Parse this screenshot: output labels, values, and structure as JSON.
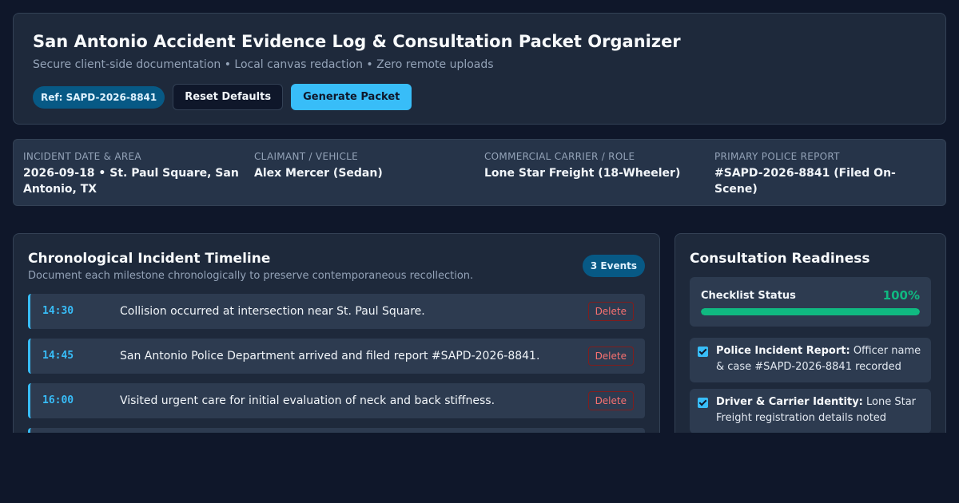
{
  "header": {
    "title": "San Antonio Accident Evidence Log & Consultation Packet Organizer",
    "subtitle": "Secure client-side documentation • Local canvas redaction • Zero remote uploads",
    "ref_badge": "Ref: SAPD-2026-8841",
    "reset_label": "Reset Defaults",
    "generate_label": "Generate Packet"
  },
  "summary": [
    {
      "label": "INCIDENT DATE & AREA",
      "value": "2026-09-18 • St. Paul Square, San Antonio, TX"
    },
    {
      "label": "CLAIMANT / VEHICLE",
      "value": "Alex Mercer (Sedan)"
    },
    {
      "label": "COMMERCIAL CARRIER / ROLE",
      "value": "Lone Star Freight (18-Wheeler)"
    },
    {
      "label": "PRIMARY POLICE REPORT",
      "value": "#SAPD-2026-8841 (Filed On-Scene)"
    }
  ],
  "timeline": {
    "title": "Chronological Incident Timeline",
    "subtitle": "Document each milestone chronologically to preserve contemporaneous recollection.",
    "count_badge": "3 Events",
    "delete_label": "Delete",
    "events": [
      {
        "time": "14:30",
        "description": "Collision occurred at intersection near St. Paul Square."
      },
      {
        "time": "14:45",
        "description": "San Antonio Police Department arrived and filed report #SAPD-2026-8841."
      },
      {
        "time": "16:00",
        "description": "Visited urgent care for initial evaluation of neck and back stiffness."
      }
    ]
  },
  "readiness": {
    "title": "Consultation Readiness",
    "status_label": "Checklist Status",
    "status_percent_text": "100%",
    "status_percent": 100,
    "accent_color": "#10b981",
    "items": [
      {
        "checked": true,
        "title": "Police Incident Report:",
        "detail": "Officer name & case #SAPD-2026-8841 recorded"
      },
      {
        "checked": true,
        "title": "Driver & Carrier Identity:",
        "detail": "Lone Star Freight registration details noted"
      }
    ]
  },
  "colors": {
    "background": "#0f172a",
    "card": "#1e293b",
    "accent": "#38bdf8",
    "success": "#10b981",
    "danger": "#f87171"
  }
}
